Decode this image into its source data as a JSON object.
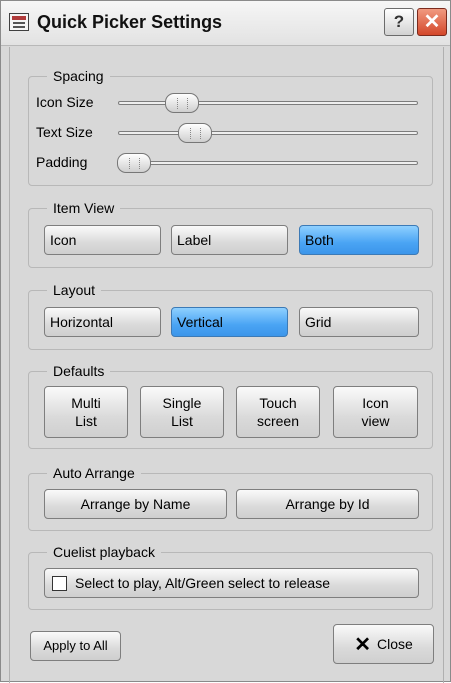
{
  "window": {
    "title": "Quick Picker Settings",
    "help_label": "?",
    "close_glyph": "✕"
  },
  "spacing": {
    "legend": "Spacing",
    "sliders": [
      {
        "label": "Icon Size",
        "level": 0.18
      },
      {
        "label": "Text Size",
        "level": 0.23
      },
      {
        "label": "Padding",
        "level": 0.0
      }
    ]
  },
  "item_view": {
    "legend": "Item View",
    "options": [
      "Icon",
      "Label",
      "Both"
    ],
    "selected": "Both"
  },
  "layout": {
    "legend": "Layout",
    "options": [
      "Horizontal",
      "Vertical",
      "Grid"
    ],
    "selected": "Vertical"
  },
  "defaults": {
    "legend": "Defaults",
    "buttons": [
      {
        "line1": "Multi",
        "line2": "List"
      },
      {
        "line1": "Single",
        "line2": "List"
      },
      {
        "line1": "Touch",
        "line2": "screen"
      },
      {
        "line1": "Icon",
        "line2": "view"
      }
    ]
  },
  "auto_arrange": {
    "legend": "Auto Arrange",
    "by_name": "Arrange by Name",
    "by_id": "Arrange by Id"
  },
  "cuelist": {
    "legend": "Cuelist playback",
    "checkbox_label": "Select to play, Alt/Green select to release",
    "checked": false
  },
  "footer": {
    "apply_all": "Apply to All",
    "close": "Close"
  },
  "colors": {
    "selected": "#4aa4f4",
    "close_titlebar": "#d3472a",
    "background": "#d8d8d8"
  }
}
